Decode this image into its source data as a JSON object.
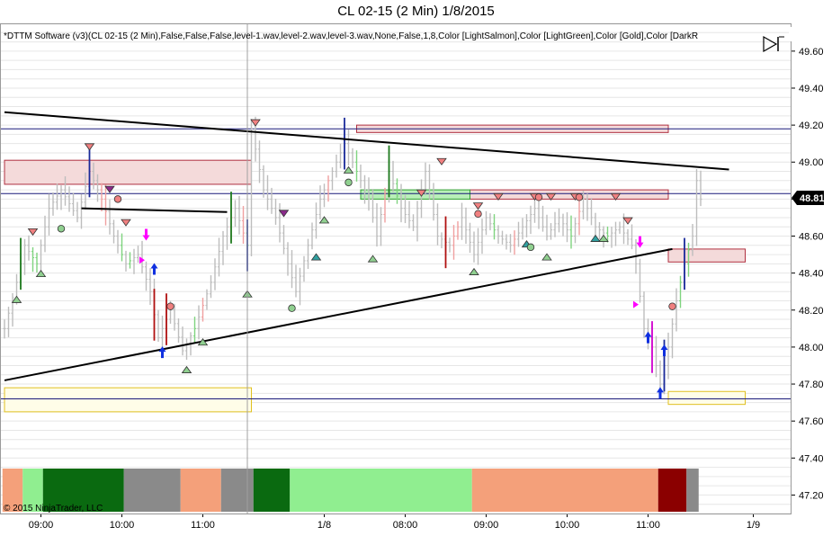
{
  "window": {
    "title": "CL 02-15 (2 Min)  1/8/2015",
    "indicator_label": "*DTTM Software (v3)(CL 02-15 (2 Min),False,False,False,level-1.wav,level-2.wav,level-3.wav,None,False,1,8,Color [LightSalmon],Color [LightGreen],Color [Gold],Color [DarkR",
    "copyright": "© 2015 NinjaTrader, LLC",
    "last_price_label": "48.81"
  },
  "colors": {
    "bar": "#bdbdbd",
    "bull": "#7fd47f",
    "bear": "#f0a0a0",
    "grid": "#e6e6e6",
    "zone_red_fill": "#f4dada",
    "zone_red_stroke": "#b03040",
    "zone_green_fill": "#b8f0b8",
    "zone_green_stroke": "#30a030",
    "zone_gold_fill": "#fffde8",
    "zone_gold_stroke": "#e0c020",
    "level_line": "#1a1a7a",
    "trend_line": "#000000",
    "last_price_bg": "#000000",
    "last_price_fg": "#ffffff"
  },
  "chart_data": {
    "type": "bar",
    "ylim": [
      47.1,
      49.75
    ],
    "y_ticks": [
      "49.60",
      "49.40",
      "49.20",
      "49.00",
      "48.80",
      "48.60",
      "48.40",
      "48.20",
      "48.00",
      "47.80",
      "47.60",
      "47.40",
      "47.20"
    ],
    "x_ticks": [
      "09:00",
      "10:00",
      "11:00",
      "1/8",
      "08:00",
      "09:00",
      "10:00",
      "11:00",
      "1/9"
    ],
    "x_tick_bar_index": [
      9,
      29,
      49,
      79,
      99,
      119,
      139,
      159,
      185
    ],
    "bar_count": 190,
    "horizontal_levels": [
      49.18,
      48.83,
      47.72
    ],
    "last_price": 48.81,
    "trend_lines": [
      {
        "from": [
          0,
          49.27
        ],
        "to": [
          179,
          48.96
        ]
      },
      {
        "from": [
          0,
          47.82
        ],
        "to": [
          165,
          48.53
        ]
      },
      {
        "from": [
          19,
          48.75
        ],
        "to": [
          55,
          48.73
        ]
      }
    ],
    "zones": [
      {
        "kind": "red",
        "from": 0,
        "to": 61,
        "top": 49.01,
        "bottom": 48.88
      },
      {
        "kind": "red",
        "from": 87,
        "to": 164,
        "top": 49.2,
        "bottom": 49.16
      },
      {
        "kind": "red",
        "from": 115,
        "to": 164,
        "top": 48.85,
        "bottom": 48.8
      },
      {
        "kind": "green",
        "from": 88,
        "to": 115,
        "top": 48.85,
        "bottom": 48.8
      },
      {
        "kind": "red",
        "from": 164,
        "to": 183,
        "top": 48.53,
        "bottom": 48.46
      },
      {
        "kind": "gold",
        "from": 0,
        "to": 61,
        "top": 47.78,
        "bottom": 47.65
      },
      {
        "kind": "gold",
        "from": 164,
        "to": 183,
        "top": 47.76,
        "bottom": 47.69
      }
    ],
    "price_path": [
      [
        0,
        48.1
      ],
      [
        3,
        48.35
      ],
      [
        5,
        48.55
      ],
      [
        8,
        48.45
      ],
      [
        11,
        48.75
      ],
      [
        14,
        48.85
      ],
      [
        18,
        48.7
      ],
      [
        21,
        48.95
      ],
      [
        24,
        48.8
      ],
      [
        27,
        48.6
      ],
      [
        30,
        48.45
      ],
      [
        33,
        48.5
      ],
      [
        36,
        48.3
      ],
      [
        38,
        48.05
      ],
      [
        41,
        48.2
      ],
      [
        44,
        47.98
      ],
      [
        47,
        48.1
      ],
      [
        51,
        48.35
      ],
      [
        54,
        48.6
      ],
      [
        57,
        48.75
      ],
      [
        60,
        48.55
      ],
      [
        61,
        49.18
      ],
      [
        64,
        48.85
      ],
      [
        67,
        48.7
      ],
      [
        70,
        48.45
      ],
      [
        72,
        48.3
      ],
      [
        75,
        48.55
      ],
      [
        78,
        48.8
      ],
      [
        81,
        48.95
      ],
      [
        84,
        49.1
      ],
      [
        87,
        48.95
      ],
      [
        90,
        48.8
      ],
      [
        92,
        48.6
      ],
      [
        95,
        48.95
      ],
      [
        98,
        48.75
      ],
      [
        101,
        48.65
      ],
      [
        104,
        48.95
      ],
      [
        107,
        48.6
      ],
      [
        110,
        48.55
      ],
      [
        113,
        48.7
      ],
      [
        116,
        48.5
      ],
      [
        119,
        48.7
      ],
      [
        122,
        48.6
      ],
      [
        125,
        48.55
      ],
      [
        128,
        48.65
      ],
      [
        131,
        48.75
      ],
      [
        134,
        48.6
      ],
      [
        137,
        48.7
      ],
      [
        140,
        48.6
      ],
      [
        143,
        48.8
      ],
      [
        146,
        48.65
      ],
      [
        149,
        48.6
      ],
      [
        152,
        48.65
      ],
      [
        155,
        48.55
      ],
      [
        156,
        48.45
      ],
      [
        158,
        48.1
      ],
      [
        160,
        48.0
      ],
      [
        162,
        47.8
      ],
      [
        164,
        48.0
      ],
      [
        166,
        48.25
      ],
      [
        168,
        48.45
      ],
      [
        170,
        48.6
      ],
      [
        171,
        48.9
      ],
      [
        172,
        48.8
      ]
    ],
    "signals_down": [
      {
        "i": 7,
        "y": 48.62,
        "c": "#f08080"
      },
      {
        "i": 21,
        "y": 49.08,
        "c": "#f08080"
      },
      {
        "i": 26,
        "y": 48.85,
        "c": "#8b2a8b"
      },
      {
        "i": 30,
        "y": 48.67,
        "c": "#f08080"
      },
      {
        "i": 62,
        "y": 49.21,
        "c": "#f08080"
      },
      {
        "i": 69,
        "y": 48.72,
        "c": "#8b2a8b"
      },
      {
        "i": 103,
        "y": 48.83,
        "c": "#f08080"
      },
      {
        "i": 108,
        "y": 49.0,
        "c": "#f08080"
      },
      {
        "i": 117,
        "y": 48.76,
        "c": "#f08080"
      },
      {
        "i": 122,
        "y": 48.81,
        "c": "#f08080"
      },
      {
        "i": 131,
        "y": 48.81,
        "c": "#f08080"
      },
      {
        "i": 135,
        "y": 48.81,
        "c": "#f08080"
      },
      {
        "i": 141,
        "y": 48.81,
        "c": "#f08080"
      },
      {
        "i": 151,
        "y": 48.81,
        "c": "#f08080"
      },
      {
        "i": 154,
        "y": 48.68,
        "c": "#f08080"
      }
    ],
    "signals_up": [
      {
        "i": 3,
        "y": 48.26,
        "c": "#90d090"
      },
      {
        "i": 9,
        "y": 48.4,
        "c": "#90d090"
      },
      {
        "i": 45,
        "y": 47.88,
        "c": "#90d090"
      },
      {
        "i": 49,
        "y": 48.03,
        "c": "#90d090"
      },
      {
        "i": 60,
        "y": 48.29,
        "c": "#90d090"
      },
      {
        "i": 77,
        "y": 48.49,
        "c": "#30a0a0"
      },
      {
        "i": 79,
        "y": 48.69,
        "c": "#90d090"
      },
      {
        "i": 85,
        "y": 48.96,
        "c": "#90d090"
      },
      {
        "i": 91,
        "y": 48.48,
        "c": "#90d090"
      },
      {
        "i": 116,
        "y": 48.41,
        "c": "#90d090"
      },
      {
        "i": 129,
        "y": 48.56,
        "c": "#30a0a0"
      },
      {
        "i": 134,
        "y": 48.49,
        "c": "#90d090"
      },
      {
        "i": 146,
        "y": 48.59,
        "c": "#30a0a0"
      },
      {
        "i": 148,
        "y": 48.59,
        "c": "#90d090"
      }
    ],
    "circles": [
      {
        "i": 14,
        "y": 48.64,
        "c": "#90d090"
      },
      {
        "i": 28,
        "y": 48.8,
        "c": "#f08080"
      },
      {
        "i": 41,
        "y": 48.22,
        "c": "#f08080"
      },
      {
        "i": 71,
        "y": 48.21,
        "c": "#90d090"
      },
      {
        "i": 85,
        "y": 48.89,
        "c": "#90d090"
      },
      {
        "i": 117,
        "y": 48.72,
        "c": "#f08080"
      },
      {
        "i": 130,
        "y": 48.54,
        "c": "#90d090"
      },
      {
        "i": 132,
        "y": 48.81,
        "c": "#f08080"
      },
      {
        "i": 142,
        "y": 48.81,
        "c": "#f08080"
      },
      {
        "i": 165,
        "y": 48.22,
        "c": "#f08080"
      }
    ],
    "blue_arrows": [
      {
        "i": 37,
        "y": 48.42
      },
      {
        "i": 39,
        "y": 47.97
      },
      {
        "i": 159,
        "y": 48.05
      },
      {
        "i": 162,
        "y": 47.75
      },
      {
        "i": 163,
        "y": 47.98
      }
    ],
    "magenta_arrows": [
      {
        "i": 35,
        "y": 48.61
      },
      {
        "i": 157,
        "y": 48.57
      }
    ],
    "magenta_side_marks": [
      {
        "i": 34,
        "y": 48.47
      },
      {
        "i": 156,
        "y": 48.23
      }
    ],
    "indicator_bands": [
      {
        "from": 0,
        "to": 5,
        "c": "#f4a07a"
      },
      {
        "from": 5,
        "to": 10,
        "c": "#90ee90"
      },
      {
        "from": 10,
        "to": 30,
        "c": "#0a6a10"
      },
      {
        "from": 30,
        "to": 44,
        "c": "#8a8a8a"
      },
      {
        "from": 44,
        "to": 54,
        "c": "#f4a07a"
      },
      {
        "from": 54,
        "to": 62,
        "c": "#8a8a8a"
      },
      {
        "from": 62,
        "to": 71,
        "c": "#0a6a10"
      },
      {
        "from": 71,
        "to": 116,
        "c": "#90ee90"
      },
      {
        "from": 116,
        "to": 162,
        "c": "#f4a07a"
      },
      {
        "from": 162,
        "to": 169,
        "c": "#8b0000"
      },
      {
        "from": 169,
        "to": 172,
        "c": "#8a8a8a"
      }
    ]
  }
}
